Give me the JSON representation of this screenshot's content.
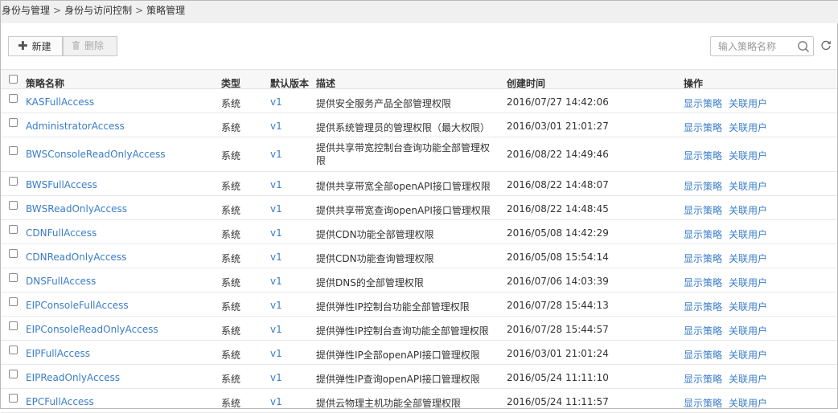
{
  "breadcrumb": {
    "items": [
      "身份与管理",
      "身份与访问控制",
      "策略管理"
    ],
    "separator": ">"
  },
  "toolbar": {
    "new_label": "新建",
    "delete_label": "删除",
    "search_placeholder": "输入策略名称"
  },
  "table": {
    "headers": {
      "name": "策略名称",
      "type": "类型",
      "version": "默认版本",
      "desc": "描述",
      "time": "创建时间",
      "op": "操作"
    },
    "actions": {
      "show": "显示策略",
      "link": "关联用户"
    },
    "rows": [
      {
        "name": "KASFullAccess",
        "type": "系统",
        "version": "v1",
        "desc": "提供安全服务产品全部管理权限",
        "time": "2016/07/27 14:42:06"
      },
      {
        "name": "AdministratorAccess",
        "type": "系统",
        "version": "v1",
        "desc": "提供系统管理员的管理权限（最大权限）",
        "time": "2016/03/01 21:01:27"
      },
      {
        "name": "BWSConsoleReadOnlyAccess",
        "type": "系统",
        "version": "v1",
        "desc": "提供共享带宽控制台查询功能全部管理权限",
        "time": "2016/08/22 14:49:46"
      },
      {
        "name": "BWSFullAccess",
        "type": "系统",
        "version": "v1",
        "desc": "提供共享带宽全部openAPI接口管理权限",
        "time": "2016/08/22 14:48:07"
      },
      {
        "name": "BWSReadOnlyAccess",
        "type": "系统",
        "version": "v1",
        "desc": "提供共享带宽查询openAPI接口管理权限",
        "time": "2016/08/22 14:48:45"
      },
      {
        "name": "CDNFullAccess",
        "type": "系统",
        "version": "v1",
        "desc": "提供CDN功能全部管理权限",
        "time": "2016/05/08 14:42:29"
      },
      {
        "name": "CDNReadOnlyAccess",
        "type": "系统",
        "version": "v1",
        "desc": "提供CDN功能查询管理权限",
        "time": "2016/05/08 15:54:14"
      },
      {
        "name": "DNSFullAccess",
        "type": "系统",
        "version": "v1",
        "desc": "提供DNS的全部管理权限",
        "time": "2016/07/06 14:03:39"
      },
      {
        "name": "EIPConsoleFullAccess",
        "type": "系统",
        "version": "v1",
        "desc": "提供弹性IP控制台功能全部管理权限",
        "time": "2016/07/28 15:44:13"
      },
      {
        "name": "EIPConsoleReadOnlyAccess",
        "type": "系统",
        "version": "v1",
        "desc": "提供弹性IP控制台查询功能全部管理权限",
        "time": "2016/07/28 15:44:57"
      },
      {
        "name": "EIPFullAccess",
        "type": "系统",
        "version": "v1",
        "desc": "提供弹性IP全部openAPI接口管理权限",
        "time": "2016/03/01 21:01:24"
      },
      {
        "name": "EIPReadOnlyAccess",
        "type": "系统",
        "version": "v1",
        "desc": "提供弹性IP查询openAPI接口管理权限",
        "time": "2016/05/24 11:11:10"
      },
      {
        "name": "EPCFullAccess",
        "type": "系统",
        "version": "v1",
        "desc": "提供云物理主机功能全部管理权限",
        "time": "2016/05/24 11:11:57"
      }
    ]
  },
  "icons": {
    "new": "plus-icon",
    "delete": "trash-icon",
    "search": "search-icon",
    "refresh": "refresh-icon"
  },
  "colors": {
    "link": "#3a7dc9",
    "header_bg": "#f7f7f7",
    "breadcrumb_bg": "#f0f0f0"
  }
}
